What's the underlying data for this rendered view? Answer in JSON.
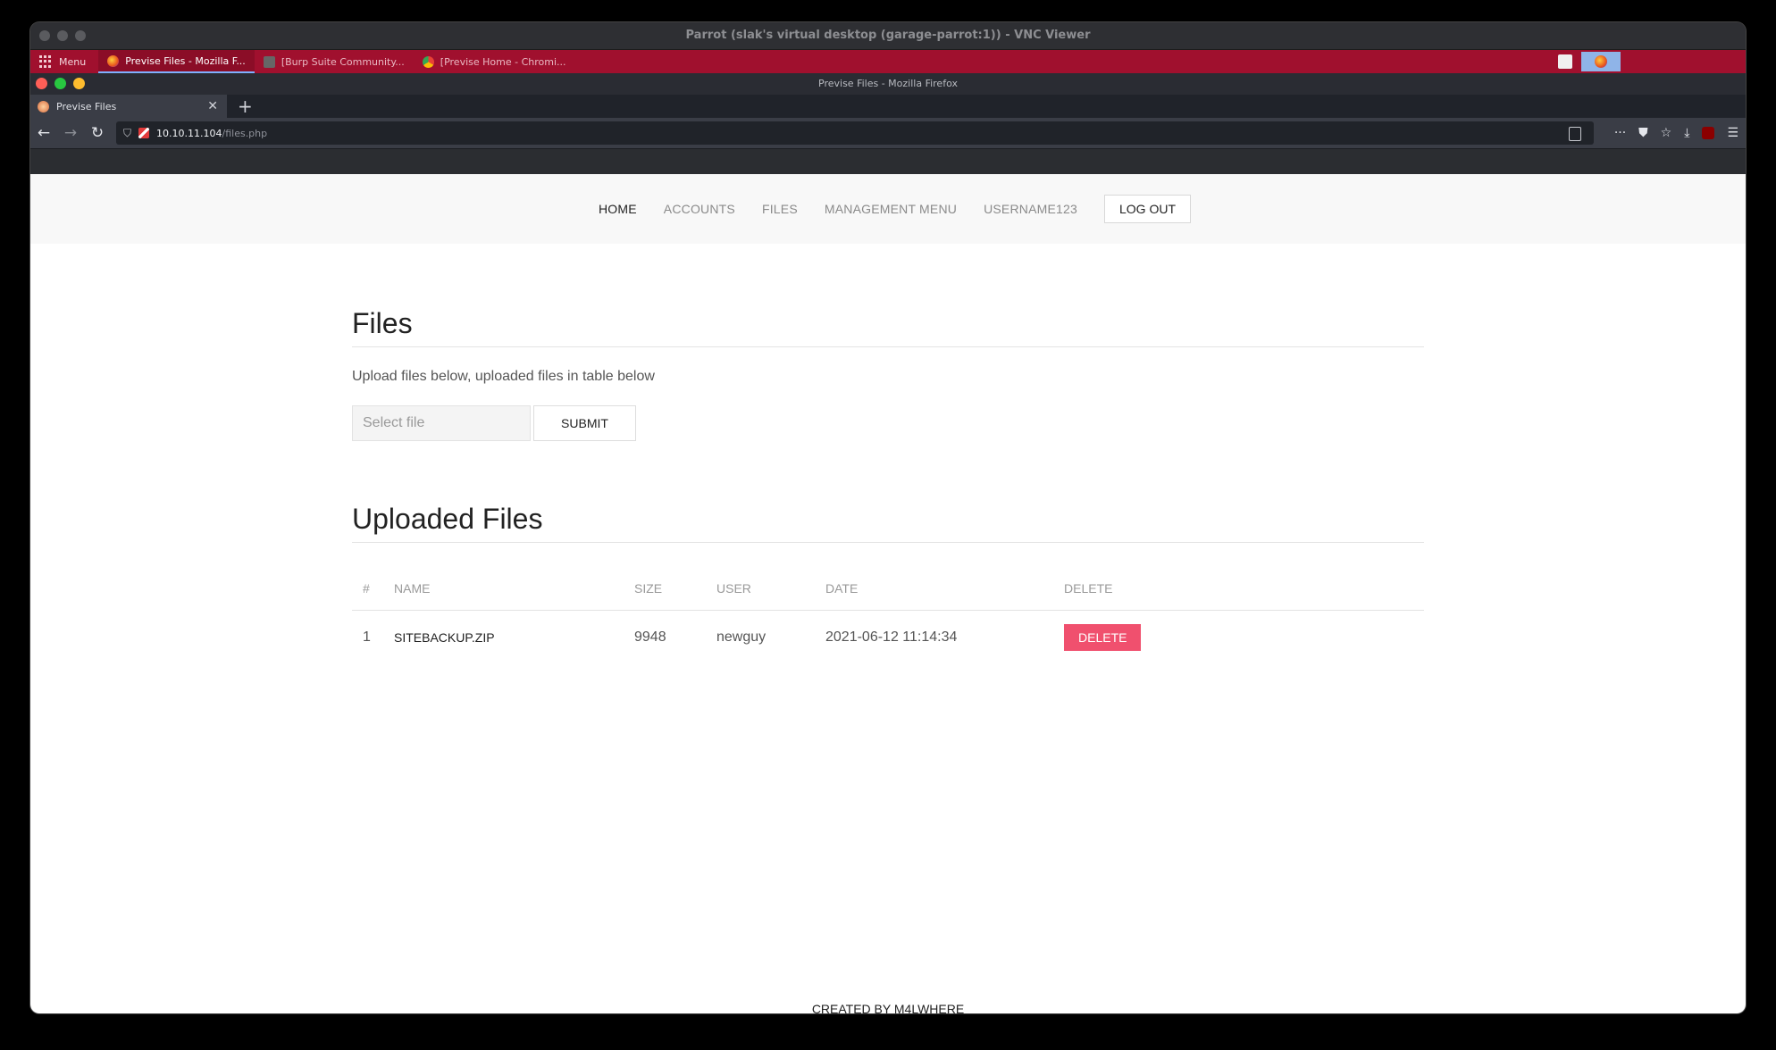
{
  "vnc": {
    "title": "Parrot (slak's virtual desktop (garage-parrot:1)) - VNC Viewer"
  },
  "panel": {
    "menu_label": "Menu",
    "tasks": [
      {
        "label": "Previse Files - Mozilla F..."
      },
      {
        "label": "[Burp Suite Community..."
      },
      {
        "label": "[Previse Home - Chromi..."
      }
    ]
  },
  "firefox": {
    "window_title": "Previse Files - Mozilla Firefox",
    "tab_title": "Previse Files",
    "url_host": "10.10.11.104",
    "url_path": "/files.php"
  },
  "site": {
    "nav": {
      "home": "HOME",
      "accounts": "ACCOUNTS",
      "files": "FILES",
      "management": "MANAGEMENT MENU",
      "username": "USERNAME123",
      "logout": "LOG OUT"
    },
    "files_heading": "Files",
    "upload_description": "Upload files below, uploaded files in table below",
    "file_input_placeholder": "Select file",
    "submit_label": "SUBMIT",
    "uploaded_heading": "Uploaded Files",
    "table": {
      "headers": [
        "#",
        "NAME",
        "SIZE",
        "USER",
        "DATE",
        "DELETE"
      ],
      "rows": [
        {
          "num": "1",
          "name": "SITEBACKUP.ZIP",
          "size": "9948",
          "user": "newguy",
          "date": "2021-06-12 11:14:34",
          "delete_label": "DELETE"
        }
      ]
    },
    "footer": "CREATED BY M4LWHERE"
  },
  "colors": {
    "panel_red": "#a0102e",
    "delete_pink": "#f0506e"
  }
}
